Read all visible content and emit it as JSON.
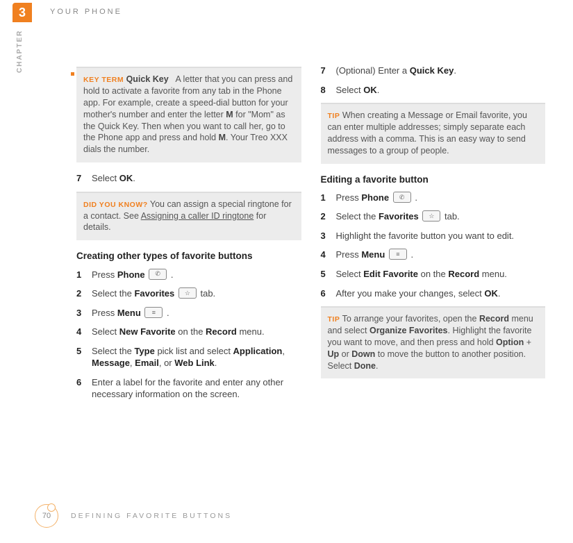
{
  "chapter_number": "3",
  "header_title": "YOUR PHONE",
  "side_label": "CHAPTER",
  "page_number": "70",
  "footer_title": "DEFINING FAVORITE BUTTONS",
  "left": {
    "keyterm": {
      "label": "KEY TERM",
      "term": "Quick Key",
      "body_a": "A letter that you can press and hold to activate a favorite from any tab in the Phone app. For example, create a speed-dial button for your mother's number and enter the letter ",
      "m1": "M",
      "body_b": " for \"Mom\" as the Quick Key. Then when you want to call her, go to the Phone app and press and hold ",
      "m2": "M",
      "body_c": ". Your Treo XXX dials the number."
    },
    "step7_num": "7",
    "step7_a": "Select ",
    "step7_b": "OK",
    "step7_c": ".",
    "didyouknow": {
      "label": "DID YOU KNOW?",
      "body_a": "You can assign a special ringtone for a contact. See ",
      "link": "Assigning a caller ID ringtone",
      "body_b": " for details."
    },
    "section_heading": "Creating other types of favorite buttons",
    "s1_num": "1",
    "s1_a": "Press ",
    "s1_b": "Phone",
    "s1_c": " .",
    "s2_num": "2",
    "s2_a": "Select the ",
    "s2_b": "Favorites",
    "s2_c": " tab.",
    "s3_num": "3",
    "s3_a": "Press ",
    "s3_b": "Menu",
    "s3_c": " .",
    "s4_num": "4",
    "s4_a": "Select ",
    "s4_b": "New Favorite",
    "s4_c": " on the ",
    "s4_d": "Record",
    "s4_e": " menu.",
    "s5_num": "5",
    "s5_a": "Select the ",
    "s5_b": "Type",
    "s5_c": " pick list and select ",
    "s5_d": "Application",
    "s5_e": ", ",
    "s5_f": "Message",
    "s5_g": ", ",
    "s5_h": "Email",
    "s5_i": ", or ",
    "s5_j": "Web Link",
    "s5_k": ".",
    "s6_num": "6",
    "s6_body": "Enter a label for the favorite and enter any other necessary information on the  screen."
  },
  "right": {
    "r7_num": "7",
    "r7_a": "(Optional)  Enter a ",
    "r7_b": "Quick Key",
    "r7_c": ".",
    "r8_num": "8",
    "r8_a": "Select ",
    "r8_b": "OK",
    "r8_c": ".",
    "tip1": {
      "label": "TIP",
      "body": "When creating a Message or Email favorite, you can enter multiple addresses; simply separate each address with a comma. This is an easy way to send messages to a group of people."
    },
    "section_heading": "Editing a favorite button",
    "e1_num": "1",
    "e1_a": "Press ",
    "e1_b": "Phone",
    "e1_c": " .",
    "e2_num": "2",
    "e2_a": "Select the ",
    "e2_b": "Favorites",
    "e2_c": " tab.",
    "e3_num": "3",
    "e3_body": "Highlight the favorite button you want to edit.",
    "e4_num": "4",
    "e4_a": "Press ",
    "e4_b": "Menu",
    "e4_c": " .",
    "e5_num": "5",
    "e5_a": "Select ",
    "e5_b": "Edit Favorite",
    "e5_c": " on the ",
    "e5_d": "Record",
    "e5_e": " menu.",
    "e6_num": "6",
    "e6_a": "After you make your changes, select ",
    "e6_b": "OK",
    "e6_c": ".",
    "tip2": {
      "label": "TIP",
      "a": "To arrange your favorites, open the ",
      "b": "Record",
      "c": " menu and select ",
      "d": "Organize Favorites",
      "e": ". Highlight the favorite you want to move, and then press and hold ",
      "f": "Option",
      "g": " + ",
      "h": "Up",
      "i": " or ",
      "j": "Down",
      "k": " to move the button to another position. Select ",
      "l": "Done",
      "m": "."
    }
  }
}
